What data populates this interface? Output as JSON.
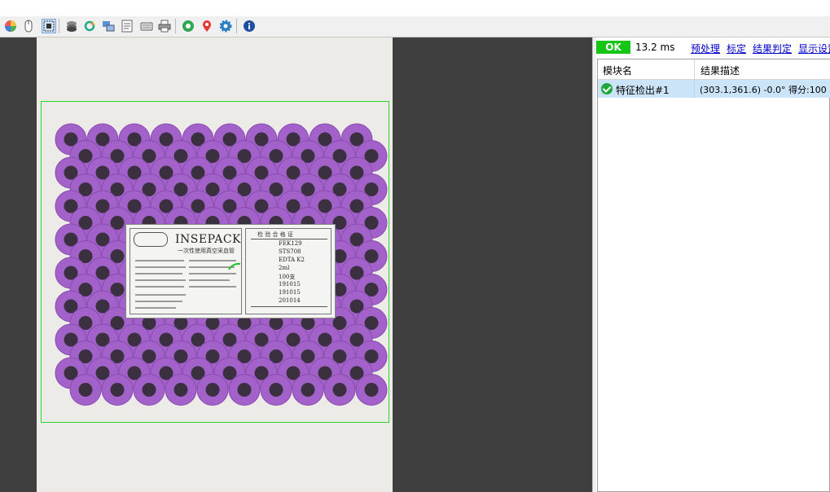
{
  "toolbar": {
    "icons": [
      "color-wheel-icon",
      "mouse-icon",
      "fit-view-icon",
      "stack-icon",
      "refresh-icon",
      "layers-icon",
      "document-icon",
      "keyboard-icon",
      "printer-icon",
      "cycle-icon",
      "location-pin-icon",
      "gear-icon",
      "info-icon"
    ],
    "active_icon": "fit-view-icon"
  },
  "status": {
    "result": "OK",
    "elapsed": "13.2 ms",
    "result_color": "#17c517"
  },
  "links": {
    "preprocess": "预处理",
    "calibrate": "标定",
    "judge": "结果判定",
    "display": "显示设置"
  },
  "results_table": {
    "columns": [
      "模块名",
      "结果描述"
    ],
    "rows": [
      {
        "module": "特征检出#1",
        "description": "(303.1,361.6) -0.0° 得分:100",
        "status_icon": "check-circle-icon"
      }
    ]
  },
  "image_view": {
    "roi_color": "#2bd62b",
    "tube_color": "#a262c9",
    "label": {
      "brand": "INSEPACK",
      "subtitle": "一次性使用真空采血管",
      "box_title": "检 验 合 格 证",
      "lines": [
        "FEK129",
        "STS708",
        "EDTA K2",
        "2ml",
        "100支",
        "191015",
        "191015",
        "201014"
      ]
    }
  }
}
